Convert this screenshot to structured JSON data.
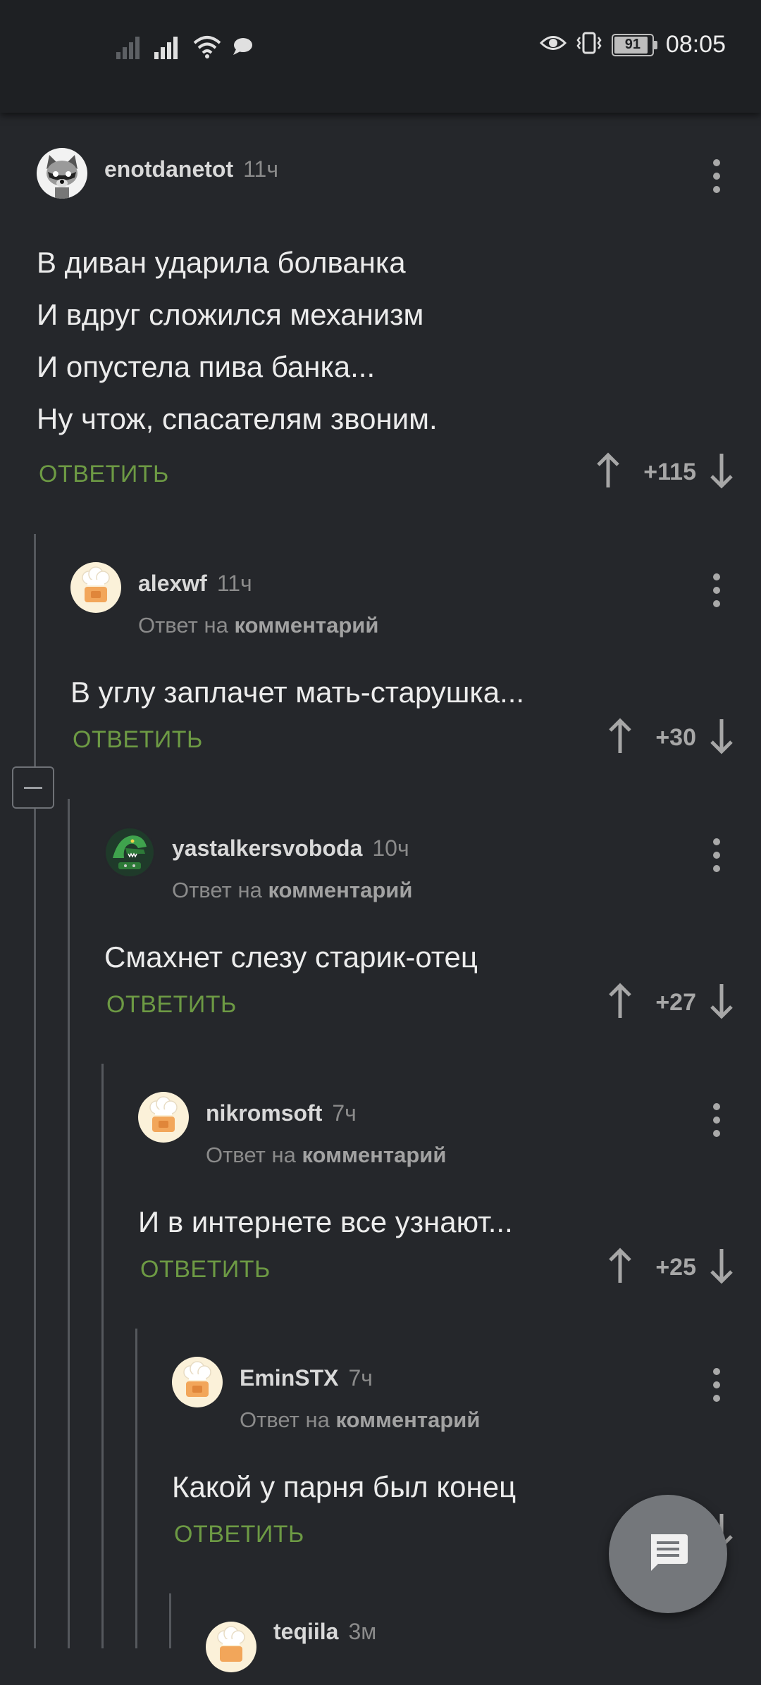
{
  "status_bar": {
    "time": "08:05",
    "battery": "91",
    "battery_level": 0.91,
    "icons": [
      "signal-icon",
      "signal-icon",
      "wifi-icon",
      "chat-bubble-icon",
      "eye-icon",
      "vibrate-icon",
      "battery-icon"
    ]
  },
  "colors": {
    "background": "#25272b",
    "reply_action": "#6d9a44",
    "muted_text": "#8b8b8b"
  },
  "common": {
    "reply_label": "ОТВЕТИТЬ",
    "reply_to_prefix": "Ответ на ",
    "reply_to_link": "комментарий"
  },
  "comments": [
    {
      "author": "enotdanetot",
      "time": "11ч",
      "lines": [
        "В диван ударила болванка",
        "И вдруг сложился механизм",
        "И опустела пива банка...",
        "Ну чтож, спасателям звоним."
      ],
      "score": "+115",
      "avatar": "raccoon-avatar"
    },
    {
      "author": "alexwf",
      "time": "11ч",
      "lines": [
        "В углу заплачет мать-старушка..."
      ],
      "score": "+30",
      "avatar": "chef-avatar"
    },
    {
      "author": "yastalkersvoboda",
      "time": "10ч",
      "lines": [
        "Смахнет слезу старик-отец"
      ],
      "score": "+27",
      "avatar": "crocodile-avatar"
    },
    {
      "author": "nikromsoft",
      "time": "7ч",
      "lines": [
        "И в интернете все узнают..."
      ],
      "score": "+25",
      "avatar": "chef-avatar"
    },
    {
      "author": "EminSTX",
      "time": "7ч",
      "lines": [
        "Какой у парня был конец"
      ],
      "score": "",
      "avatar": "chef-avatar"
    },
    {
      "author": "teqiila",
      "time": "3м",
      "avatar": "chef-avatar"
    }
  ],
  "fab": {
    "icon": "message-icon"
  }
}
